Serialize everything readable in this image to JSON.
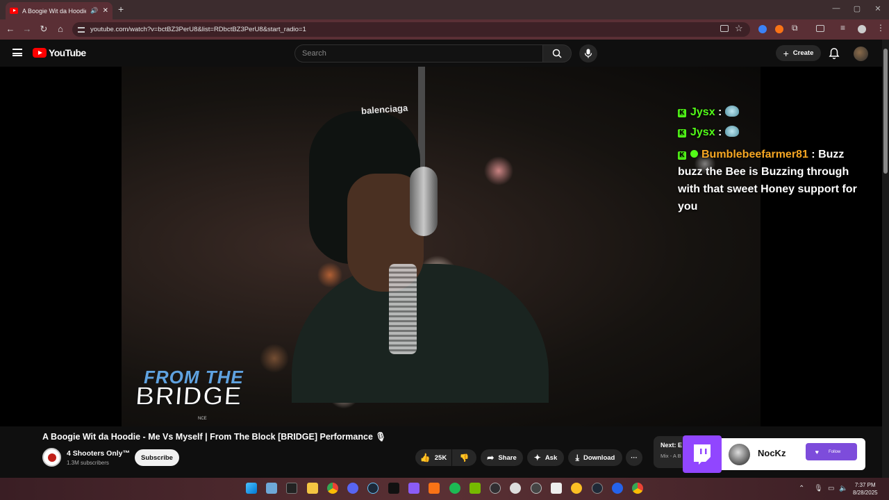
{
  "browser": {
    "tab_title": "A Boogie Wit da Hoodie - I",
    "tab_audio_icon": "speaker-icon",
    "new_tab_label": "+",
    "url": "youtube.com/watch?v=bctBZ3PerU8&list=RDbctBZ3PerU8&start_radio=1",
    "window_controls": [
      "—",
      "▢",
      "✕"
    ]
  },
  "youtube": {
    "logo_text": "YouTube",
    "search_placeholder": "Search",
    "create_label": "Create"
  },
  "video": {
    "title": "A Boogie Wit da Hoodie - Me Vs Myself | From The Block [BRIDGE] Performance 🎙",
    "overlay_brand_top": "FROM THE",
    "overlay_brand_main": "BRIDGE",
    "overlay_brand_small": "NCE",
    "beanie_text": "balenciaga"
  },
  "chat": [
    {
      "user": "Jysx",
      "message": ":"
    },
    {
      "user": "Jysx",
      "message": ":"
    },
    {
      "user": "Bumblebeefarmer81",
      "message": ": Buzz buzz the Bee is Buzzing through with that sweet Honey support for you"
    }
  ],
  "channel": {
    "name": "4 Shooters Only™",
    "subscribers": "1.3M subscribers",
    "subscribe_label": "Subscribe"
  },
  "actions": {
    "likes": "25K",
    "share": "Share",
    "ask": "Ask",
    "download": "Download",
    "more": "···"
  },
  "next_up": {
    "label": "Next: E",
    "sub": "Mix - A B"
  },
  "twitch": {
    "streamer": "NocKz",
    "follow_label": "Follow"
  },
  "taskbar": {
    "time": "7:37 PM",
    "date": "8/28/2025"
  },
  "colors": {
    "chrome_tab_bar": "#3c2c2e",
    "chrome_toolbar": "#5a2f35",
    "youtube_red": "#ff0000",
    "kick_green": "#53fc18",
    "twitch_purple": "#9146ff"
  }
}
